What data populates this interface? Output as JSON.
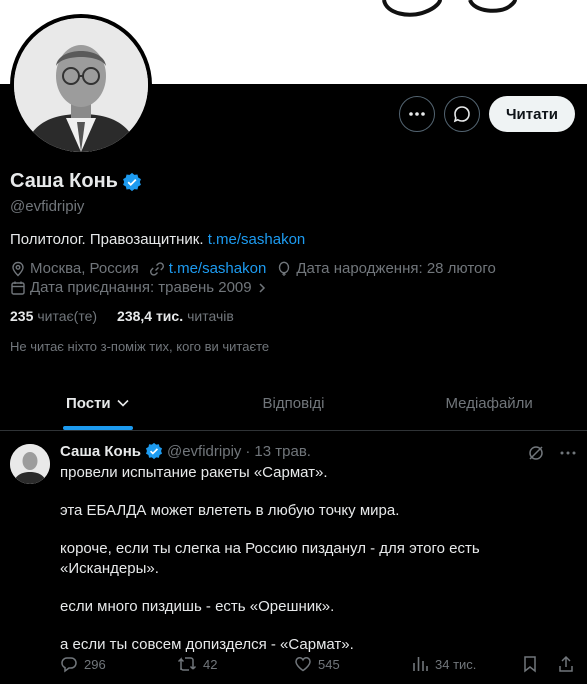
{
  "profile": {
    "name": "Саша Конь",
    "handle": "@evfidripiy",
    "bio_text": "Политолог. Правозащитник.",
    "bio_link": "t.me/sashakon",
    "location": "Москва, Россия",
    "website": "t.me/sashakon",
    "birthday": "Дата народження: 28 лютого",
    "joined": "Дата приєднання: травень 2009",
    "following_count": "235",
    "following_label": "читає(те)",
    "followers_count": "238,4 тис.",
    "followers_label": "читачів",
    "mutual_text": "Не читає ніхто з-поміж тих, кого ви читаєте"
  },
  "actions": {
    "follow_label": "Читати",
    "more_icon": "more-icon",
    "message_icon": "message-icon"
  },
  "tabs": [
    {
      "label": "Пости",
      "active": true
    },
    {
      "label": "Відповіді",
      "active": false
    },
    {
      "label": "Медіафайли",
      "active": false
    }
  ],
  "post": {
    "author": "Саша Конь",
    "handle": "@evfidripiy",
    "separator": "·",
    "date": "13 трав.",
    "lines": [
      "провели испытание ракеты «Сармат».",
      "эта ЕБАЛДА может влететь в любую точку мира.",
      "короче, если ты слегка на Россию пизданул - для этого есть «Искандеры».",
      "если много пиздишь - есть «Орешник».",
      "а если ты совсем допизделся - «Сармат»."
    ],
    "replies": "296",
    "reposts": "42",
    "likes": "545",
    "views": "34 тис."
  },
  "colors": {
    "accent": "#1d9bf0",
    "background": "#000000",
    "muted": "#71767b"
  }
}
